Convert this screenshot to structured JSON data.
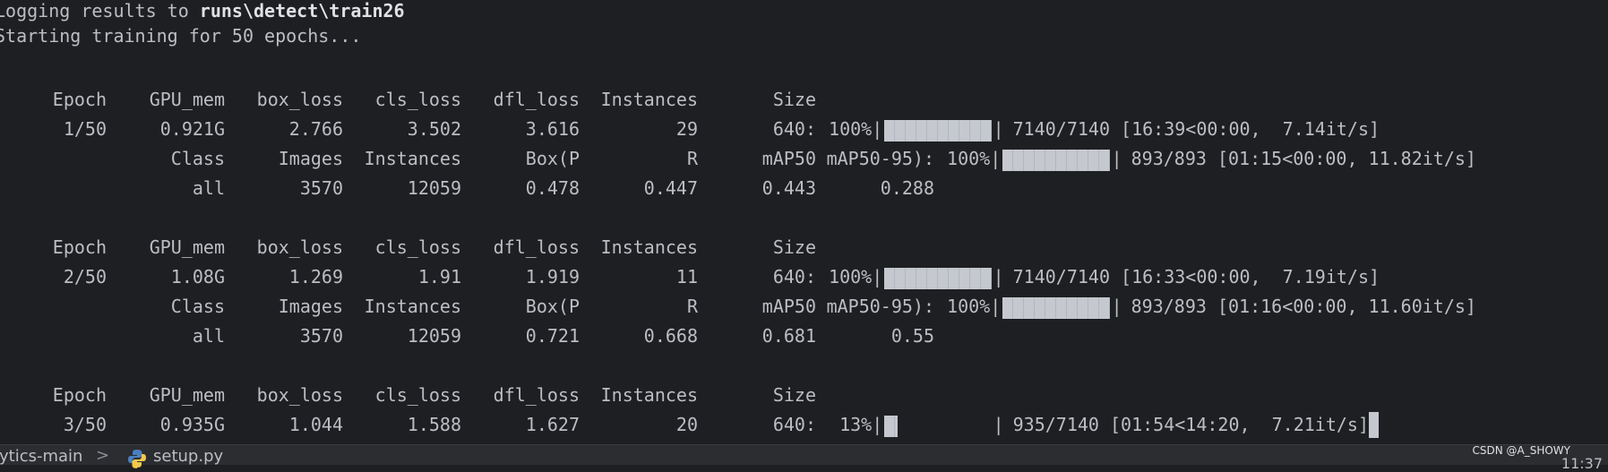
{
  "log": {
    "logging_prefix": "Logging results to ",
    "logging_path": "runs\\detect\\train26",
    "starting": "Starting training for 50 epochs..."
  },
  "train_headers": [
    "Epoch",
    "GPU_mem",
    "box_loss",
    "cls_loss",
    "dfl_loss",
    "Instances",
    "Size"
  ],
  "val_headers": [
    "Class",
    "Images",
    "Instances",
    "Box(P",
    "R",
    "mAP50",
    "mAP50-95):"
  ],
  "epochs": [
    {
      "train": [
        "1/50",
        "0.921G",
        "2.766",
        "3.502",
        "3.616",
        "29",
        "640:"
      ],
      "train_progress": {
        "percent_text": "100%",
        "fraction": 1.0,
        "tail": " 7140/7140 [16:39<00:00,  7.14it/s]"
      },
      "val_progress": {
        "percent_text": "100%",
        "fraction": 1.0,
        "tail": " 893/893 [01:15<00:00, 11.82it/s]"
      },
      "val_result": [
        "all",
        "3570",
        "12059",
        "0.478",
        "0.447",
        "0.443",
        "0.288"
      ]
    },
    {
      "train": [
        "2/50",
        "1.08G",
        "1.269",
        "1.91",
        "1.919",
        "11",
        "640:"
      ],
      "train_progress": {
        "percent_text": "100%",
        "fraction": 1.0,
        "tail": " 7140/7140 [16:33<00:00,  7.19it/s]"
      },
      "val_progress": {
        "percent_text": "100%",
        "fraction": 1.0,
        "tail": " 893/893 [01:16<00:00, 11.60it/s]"
      },
      "val_result": [
        "all",
        "3570",
        "12059",
        "0.721",
        "0.668",
        "0.681",
        "0.55"
      ]
    },
    {
      "train": [
        "3/50",
        "0.935G",
        "1.044",
        "1.588",
        "1.627",
        "20",
        "640:"
      ],
      "train_progress": {
        "percent_text": " 13%",
        "fraction": 0.13,
        "tail": " 935/7140 [01:54<14:20,  7.21it/s]"
      }
    }
  ],
  "statusbar": {
    "project": "lytics-main",
    "separator": ">",
    "file": "setup.py",
    "python_icon": "python-icon"
  },
  "watermark": "CSDN @A_SHOWY",
  "clock": "11:37",
  "colors": {
    "background": "#1e1f22",
    "text": "#bcbec4",
    "bar": "#c5c8cf",
    "statusbar": "#2b2d30",
    "python_blue": "#4a7fbf",
    "python_yellow": "#f2c94c"
  }
}
